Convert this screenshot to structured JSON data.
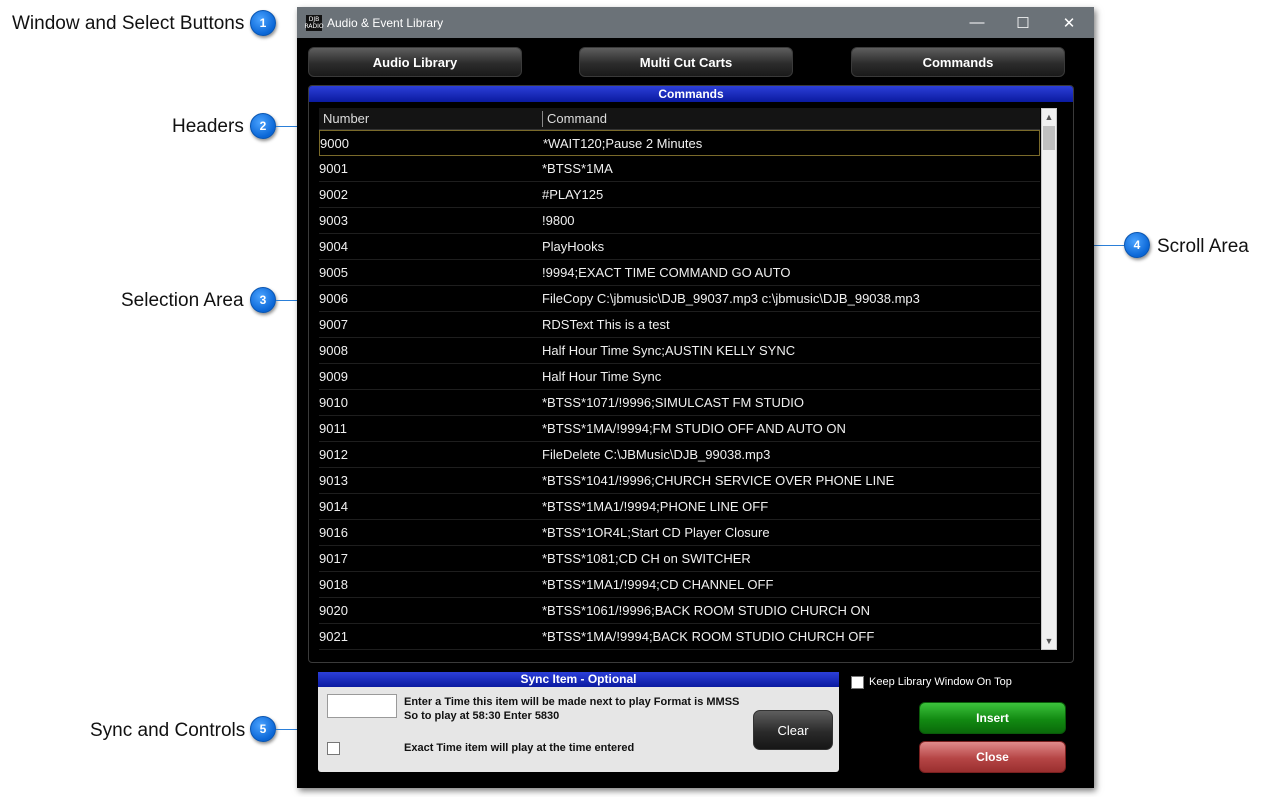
{
  "callouts": [
    {
      "number": "1",
      "label": "Window and Select Buttons"
    },
    {
      "number": "2",
      "label": "Headers"
    },
    {
      "number": "3",
      "label": "Selection Area"
    },
    {
      "number": "4",
      "label": "Scroll Area"
    },
    {
      "number": "5",
      "label": "Sync and Controls"
    }
  ],
  "window": {
    "logo_text": "DJB RADIO",
    "title": "Audio & Event Library",
    "controls": {
      "minimize": "—",
      "maximize": "☐",
      "close": "✕"
    }
  },
  "tabs": {
    "audio_library": "Audio Library",
    "multi_cut_carts": "Multi Cut Carts",
    "commands": "Commands"
  },
  "panel": {
    "title": "Commands",
    "columns": {
      "number": "Number",
      "command": "Command"
    },
    "selected_index": 0,
    "rows": [
      {
        "number": "9000",
        "command": "*WAIT120;Pause 2 Minutes"
      },
      {
        "number": "9001",
        "command": "*BTSS*1MA"
      },
      {
        "number": "9002",
        "command": "#PLAY125"
      },
      {
        "number": "9003",
        "command": "!9800"
      },
      {
        "number": "9004",
        "command": "PlayHooks"
      },
      {
        "number": "9005",
        "command": "!9994;EXACT TIME COMMAND GO AUTO"
      },
      {
        "number": "9006",
        "command": "FileCopy C:\\jbmusic\\DJB_99037.mp3 c:\\jbmusic\\DJB_99038.mp3"
      },
      {
        "number": "9007",
        "command": "RDSText This is a test"
      },
      {
        "number": "9008",
        "command": "Half Hour Time Sync;AUSTIN KELLY SYNC"
      },
      {
        "number": "9009",
        "command": "Half Hour Time Sync"
      },
      {
        "number": "9010",
        "command": "*BTSS*1071/!9996;SIMULCAST FM STUDIO"
      },
      {
        "number": "9011",
        "command": "*BTSS*1MA/!9994;FM STUDIO OFF AND AUTO ON"
      },
      {
        "number": "9012",
        "command": "FileDelete C:\\JBMusic\\DJB_99038.mp3"
      },
      {
        "number": "9013",
        "command": "*BTSS*1041/!9996;CHURCH SERVICE OVER PHONE LINE"
      },
      {
        "number": "9014",
        "command": "*BTSS*1MA1/!9994;PHONE LINE OFF"
      },
      {
        "number": "9016",
        "command": "*BTSS*1OR4L;Start CD Player Closure"
      },
      {
        "number": "9017",
        "command": "*BTSS*1081;CD CH on SWITCHER"
      },
      {
        "number": "9018",
        "command": "*BTSS*1MA1/!9994;CD CHANNEL  OFF"
      },
      {
        "number": "9020",
        "command": "*BTSS*1061/!9996;BACK ROOM STUDIO CHURCH ON"
      },
      {
        "number": "9021",
        "command": "*BTSS*1MA/!9994;BACK ROOM STUDIO CHURCH OFF"
      }
    ]
  },
  "scrollbar": {
    "up": "▲",
    "down": "▼"
  },
  "sync": {
    "title": "Sync Item - Optional",
    "time_value": "",
    "description": "Enter a Time this item will be made next to play  Format is MMSS  So to play at 58:30 Enter 5830",
    "exact_time_label": "Exact Time item will play at the time entered",
    "exact_time_checked": false,
    "clear_label": "Clear"
  },
  "controls": {
    "keep_on_top_label": "Keep Library Window On Top",
    "keep_on_top_checked": false,
    "insert_label": "Insert",
    "close_label": "Close"
  },
  "colors": {
    "panel_header": "#0a1aa0",
    "insert": "#128a12",
    "close": "#b54545",
    "callout": "#0a66d6"
  }
}
